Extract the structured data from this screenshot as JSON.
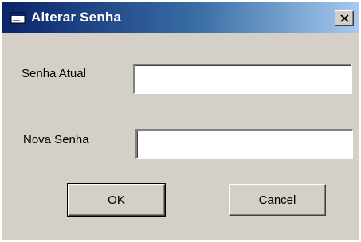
{
  "window": {
    "title": "Alterar Senha",
    "close_symbol": "×"
  },
  "form": {
    "current_password_label": "Senha Atual",
    "current_password_value": "",
    "new_password_label": "Nova Senha",
    "new_password_value": ""
  },
  "buttons": {
    "ok_label": "OK",
    "cancel_label": "Cancel"
  },
  "colors": {
    "titlebar_start": "#0a246a",
    "titlebar_end": "#a6caf0",
    "dialog_face": "#d4d0c8"
  },
  "icons": {
    "app": "window-app-icon",
    "close": "close-icon"
  }
}
